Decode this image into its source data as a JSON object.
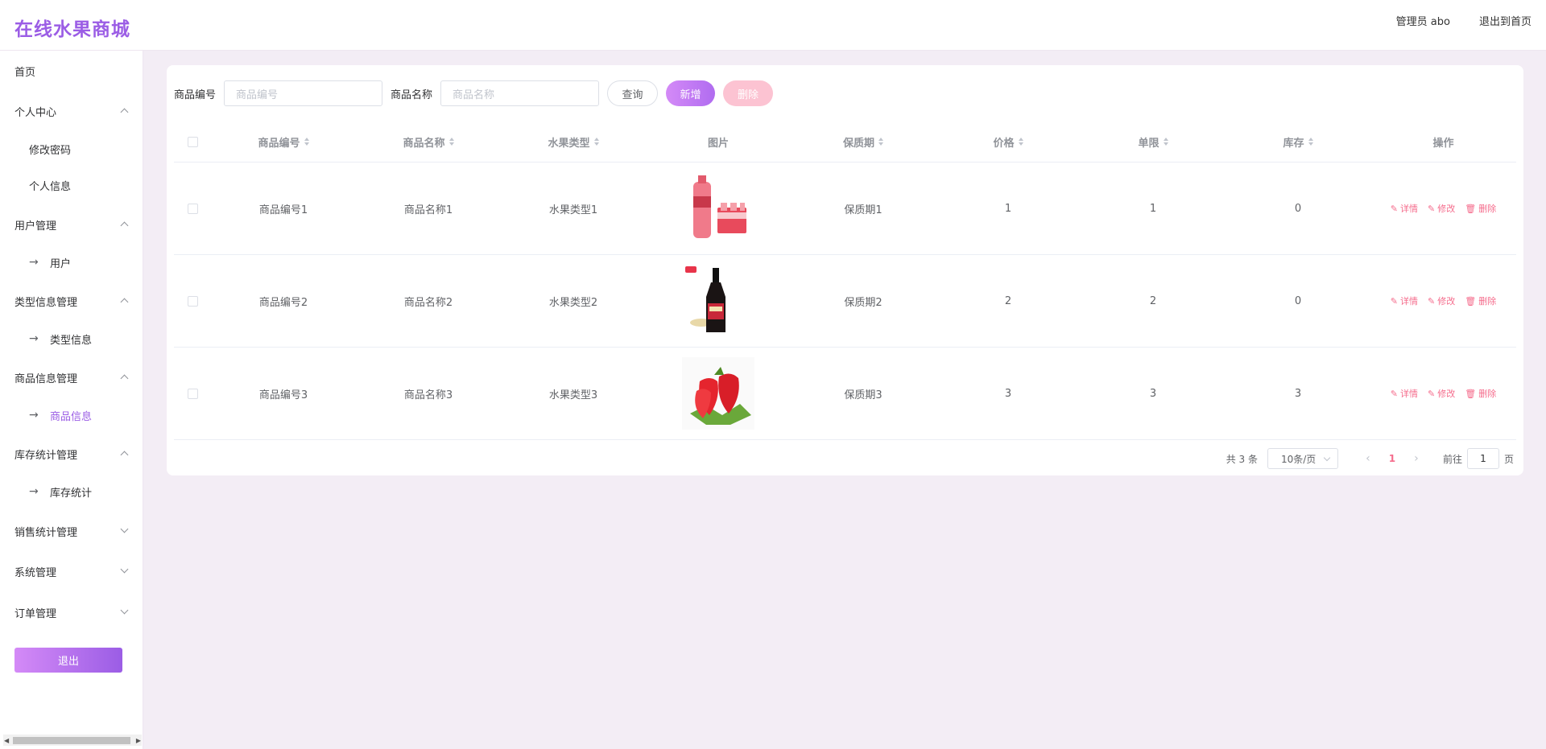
{
  "header": {
    "brand": "在线水果商城",
    "user": "管理员 abo",
    "back_home": "退出到首页"
  },
  "sidebar": {
    "home": "首页",
    "personal_center": "个人中心",
    "change_password": "修改密码",
    "personal_info": "个人信息",
    "user_mgmt": "用户管理",
    "user": "用户",
    "type_mgmt": "类型信息管理",
    "type_info": "类型信息",
    "goods_mgmt": "商品信息管理",
    "goods_info": "商品信息",
    "stock_mgmt": "库存统计管理",
    "stock_stats": "库存统计",
    "sales_mgmt": "销售统计管理",
    "system_mgmt": "系统管理",
    "order_mgmt": "订单管理",
    "logout": "退出"
  },
  "search": {
    "code_label": "商品编号",
    "code_placeholder": "商品编号",
    "name_label": "商品名称",
    "name_placeholder": "商品名称",
    "query": "查询",
    "add": "新增",
    "delete": "删除"
  },
  "table": {
    "headers": [
      "商品编号",
      "商品名称",
      "水果类型",
      "图片",
      "保质期",
      "价格",
      "单限",
      "库存",
      "操作"
    ],
    "rows": [
      {
        "code": "商品编号1",
        "name": "商品名称1",
        "type": "水果类型1",
        "image": "pink-drink-image",
        "shelf": "保质期1",
        "price": "1",
        "limit": "1",
        "stock": "0"
      },
      {
        "code": "商品编号2",
        "name": "商品名称2",
        "type": "水果类型2",
        "image": "soy-sauce-bottle-image",
        "shelf": "保质期2",
        "price": "2",
        "limit": "2",
        "stock": "0"
      },
      {
        "code": "商品编号3",
        "name": "商品名称3",
        "type": "水果类型3",
        "image": "strawberries-image",
        "shelf": "保质期3",
        "price": "3",
        "limit": "3",
        "stock": "3"
      }
    ],
    "ops": {
      "detail": "详情",
      "edit": "修改",
      "delete": "删除"
    }
  },
  "pager": {
    "total": "共 3 条",
    "page_size": "10条/页",
    "current": "1",
    "goto": "前往",
    "goto_value": "1",
    "page_unit": "页"
  },
  "colors": {
    "accent": "#9b5de5",
    "danger": "#f56c8c",
    "bg": "#f3edf5"
  }
}
